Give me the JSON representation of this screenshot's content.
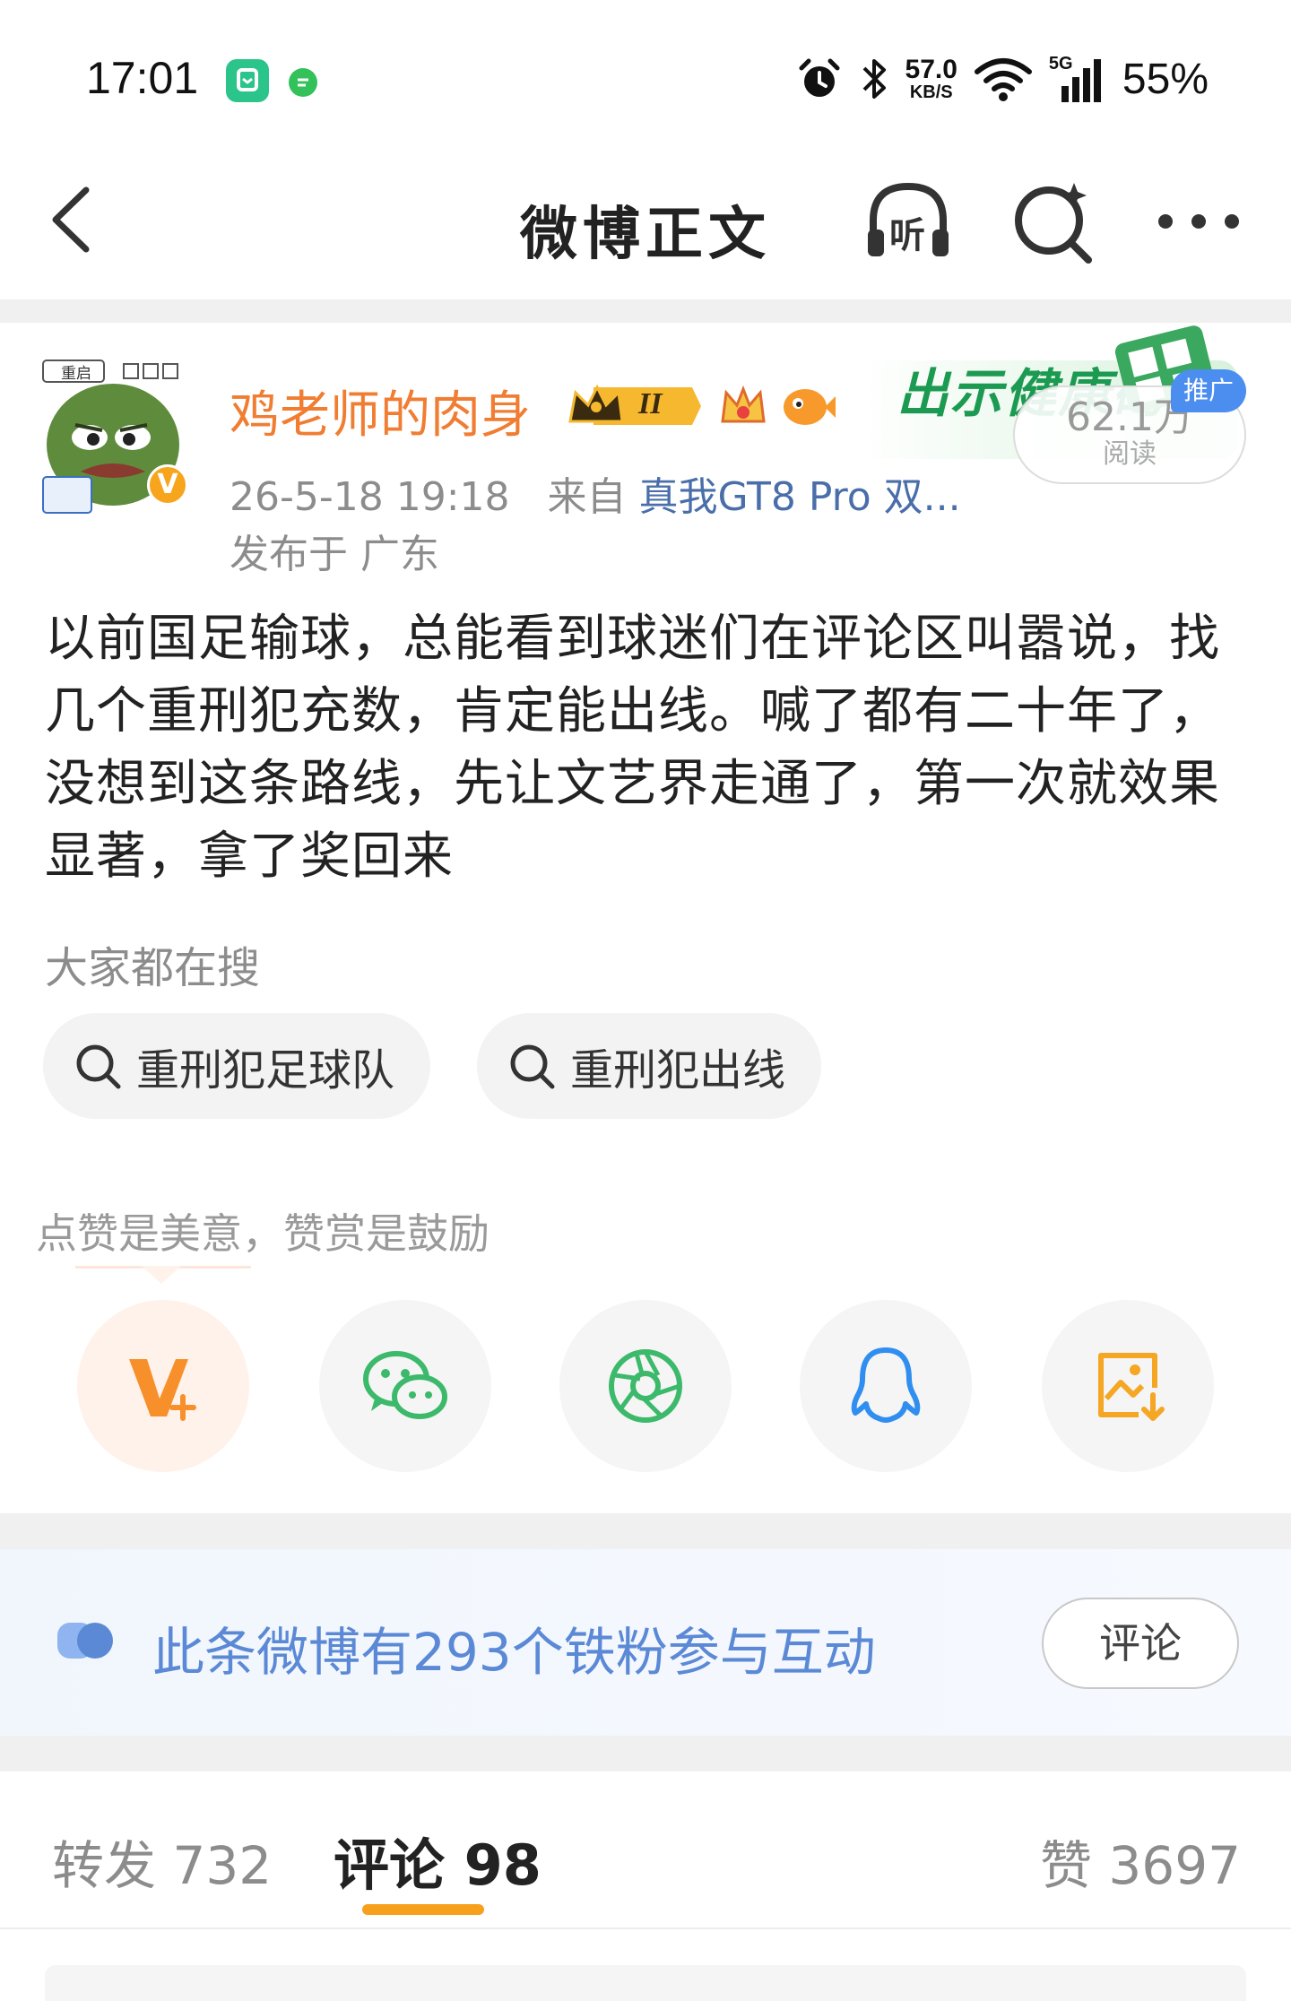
{
  "status_bar": {
    "time": "17:01",
    "net_speed_value": "57.0",
    "net_speed_unit": "KB/S",
    "signal_label": "5G",
    "battery": "55%",
    "icons": [
      "app-notification-icon",
      "message-notification-icon",
      "alarm-icon",
      "bluetooth-icon",
      "wifi-icon",
      "signal-icon"
    ]
  },
  "nav": {
    "title": "微博正文",
    "listen_label": "听",
    "icons": [
      "back-icon",
      "listen-icon",
      "search-icon",
      "more-icon"
    ]
  },
  "post": {
    "author_name": "鸡老师的肉身",
    "badge_level": "II",
    "avatar_badge_text": "V",
    "avatar_sticker_text": "重启",
    "datetime": "26-5-18 19:18",
    "source_prefix": "来自",
    "source": "真我GT8 Pro 双...",
    "location": "发布于 广东",
    "promo_text": "出示健康码",
    "promo_tag": "推广",
    "read_count": "62.1万",
    "read_label": "阅读",
    "body": "以前国足输球，总能看到球迷们在评论区叫嚣说，找几个重刑犯充数，肯定能出线。喊了都有二十年了， 没想到这条路线，先让文艺界走通了，第一次就效果显著，拿了奖回来"
  },
  "search_section": {
    "title": "大家都在搜",
    "chips": [
      {
        "label": "重刑犯足球队"
      },
      {
        "label": "重刑犯出线"
      }
    ]
  },
  "reward": {
    "hint": "点赞是美意，赞赏是鼓励",
    "share_buttons": [
      {
        "icon": "reward-v-plus-icon",
        "color": "#f7902a"
      },
      {
        "icon": "wechat-icon",
        "color": "#3cb96b"
      },
      {
        "icon": "moments-icon",
        "color": "#3cb96b"
      },
      {
        "icon": "qq-icon",
        "color": "#2f8ef0"
      },
      {
        "icon": "save-image-icon",
        "color": "#f5a623"
      }
    ]
  },
  "fans_bar": {
    "text": "此条微博有293个铁粉参与互动",
    "button": "评论"
  },
  "tabs": {
    "repost": "转发 732",
    "comment": "评论 98",
    "like": "赞 3697",
    "accent": "#f7a01b"
  }
}
